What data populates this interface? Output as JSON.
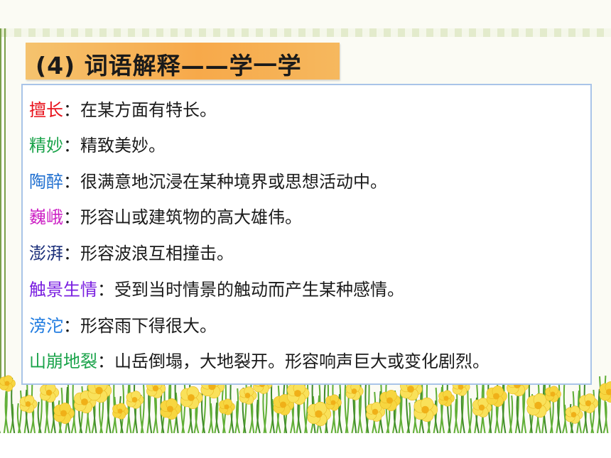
{
  "title": "(4) 词语解释——学一学",
  "sep": "：",
  "entries": [
    {
      "term": "擅长",
      "definition": "在某方面有特长。",
      "color": "#e8101a"
    },
    {
      "term": "精妙",
      "definition": "精致美妙。",
      "color": "#1aa34a"
    },
    {
      "term": "陶醉",
      "definition": "很满意地沉浸在某种境界或思想活动中。",
      "color": "#1f6fd0"
    },
    {
      "term": "巍峨",
      "definition": "形容山或建筑物的高大雄伟。",
      "color": "#cc1fc4"
    },
    {
      "term": "澎湃",
      "definition": "形容波浪互相撞击。",
      "color": "#1b2f7a"
    },
    {
      "term": "触景生情",
      "definition": "受到当时情景的触动而产生某种感情。",
      "color": "#7a1fe0"
    },
    {
      "term": "滂沱",
      "definition": "形容雨下得很大。",
      "color": "#1f7be0"
    },
    {
      "term": "山崩地裂",
      "definition": "山岳倒塌，大地裂开。形容响声巨大或变化剧烈。",
      "color": "#1aa34a"
    }
  ]
}
